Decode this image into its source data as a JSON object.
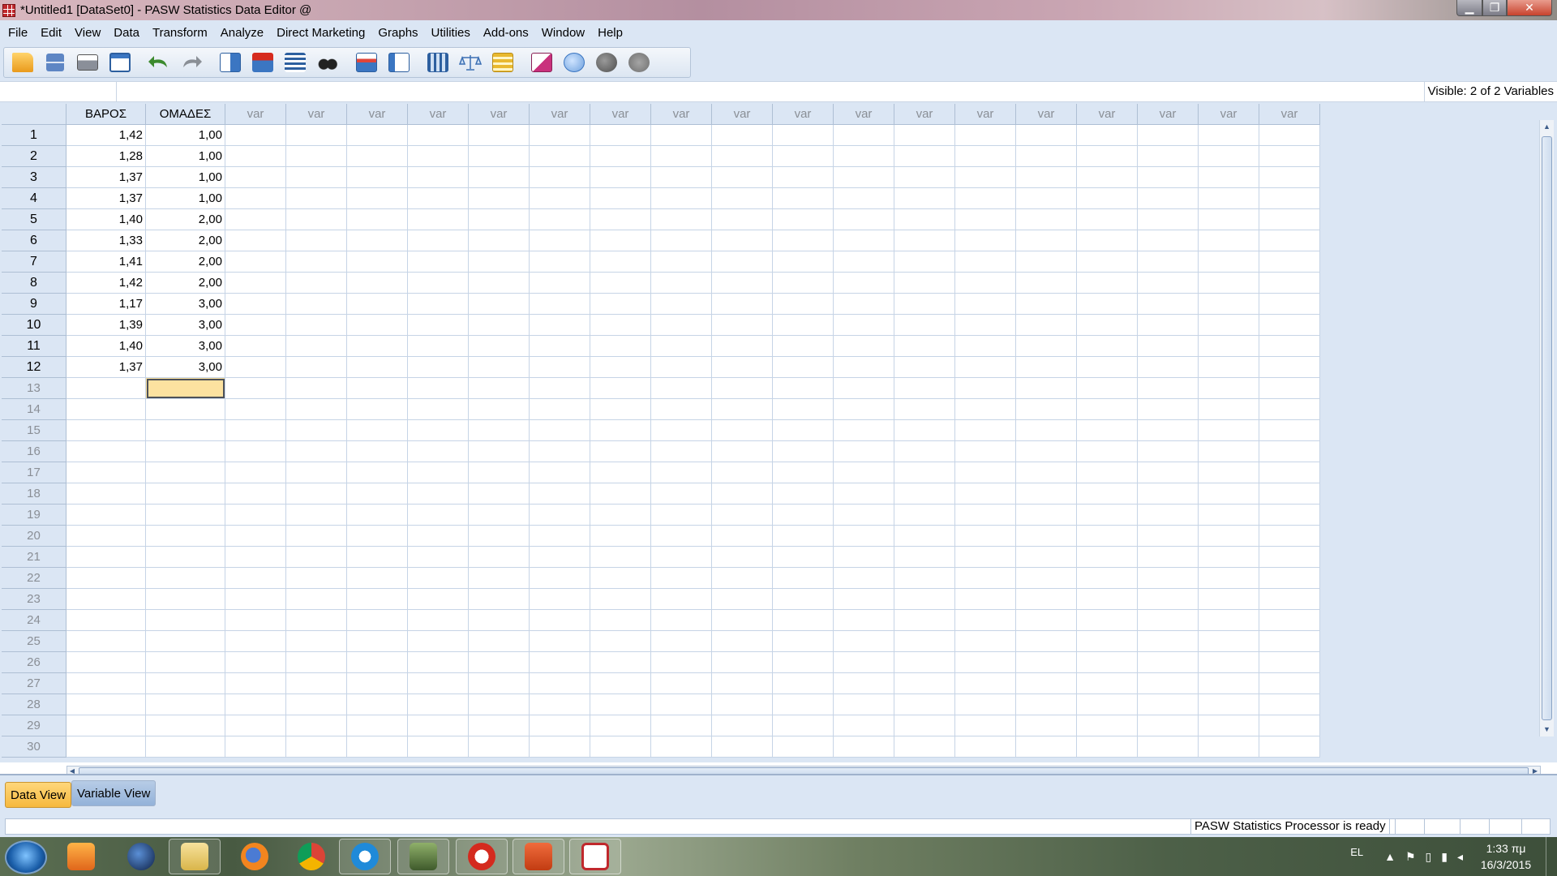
{
  "window": {
    "title": "*Untitled1 [DataSet0] - PASW Statistics Data Editor @",
    "minimize": "▁",
    "maximize": "❐",
    "close": "✕"
  },
  "menu": [
    "File",
    "Edit",
    "View",
    "Data",
    "Transform",
    "Analyze",
    "Direct Marketing",
    "Graphs",
    "Utilities",
    "Add-ons",
    "Window",
    "Help"
  ],
  "toolbar": {
    "icons": [
      "open-folder-icon",
      "save-icon",
      "print-icon",
      "recall-dialog-icon",
      "undo-icon",
      "redo-icon",
      "goto-case-icon",
      "goto-variable-icon",
      "variables-icon",
      "find-icon",
      "insert-cases-icon",
      "insert-variable-icon",
      "split-file-icon",
      "weight-cases-icon",
      "select-cases-icon",
      "value-labels-icon",
      "use-sets-icon",
      "show-all-variables-icon",
      "spell-check-icon"
    ]
  },
  "cellbar": {
    "cell_name": "",
    "cell_value": "",
    "visible_text": "Visible: 2 of 2 Variables"
  },
  "grid": {
    "columns": [
      "ΒΑΡΟΣ",
      "ΟΜΑΔΕΣ"
    ],
    "empty_column_label": "var",
    "empty_column_count": 18,
    "rows": [
      [
        "1,42",
        "1,00"
      ],
      [
        "1,28",
        "1,00"
      ],
      [
        "1,37",
        "1,00"
      ],
      [
        "1,37",
        "1,00"
      ],
      [
        "1,40",
        "2,00"
      ],
      [
        "1,33",
        "2,00"
      ],
      [
        "1,41",
        "2,00"
      ],
      [
        "1,42",
        "2,00"
      ],
      [
        "1,17",
        "3,00"
      ],
      [
        "1,39",
        "3,00"
      ],
      [
        "1,40",
        "3,00"
      ],
      [
        "1,37",
        "3,00"
      ]
    ],
    "total_rows_visible": 30,
    "selected_cell": {
      "row": 13,
      "column": "ΟΜΑΔΕΣ"
    }
  },
  "tabs": {
    "data_view": "Data View",
    "variable_view": "Variable View",
    "active": "Data View"
  },
  "status": {
    "message": "PASW Statistics Processor is ready"
  },
  "taskbar": {
    "apps": [
      "windows-media-player-icon",
      "globe-icon",
      "file-explorer-icon",
      "firefox-icon",
      "chrome-icon",
      "internet-explorer-icon",
      "task-app-icon",
      "download-app-icon",
      "powerpoint-icon",
      "pasw-statistics-icon"
    ],
    "language": "EL",
    "time": "1:33 πμ",
    "date": "16/3/2015"
  },
  "colors": {
    "chrome_blue": "#dbe6f4",
    "selected_cell": "#fce2a0",
    "active_tab": "#f6b93e"
  }
}
